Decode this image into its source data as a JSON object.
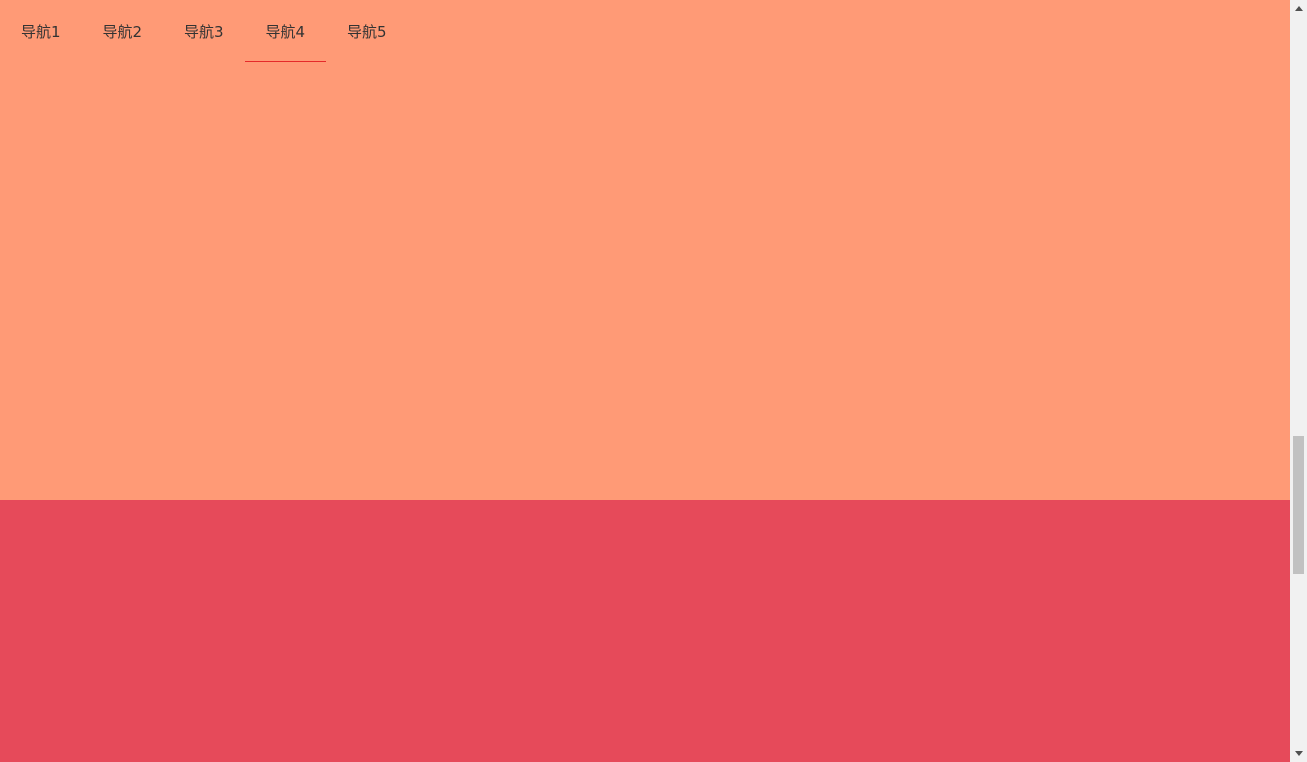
{
  "nav": {
    "items": [
      {
        "label": "导航1",
        "active": false
      },
      {
        "label": "导航2",
        "active": false
      },
      {
        "label": "导航3",
        "active": false
      },
      {
        "label": "导航4",
        "active": true
      },
      {
        "label": "导航5",
        "active": false
      }
    ]
  },
  "colors": {
    "section_orange": "#ff9a76",
    "section_red": "#e64a5a",
    "nav_active_underline": "#e52a2a",
    "nav_text": "#333333",
    "scrollbar_track": "#f1f1f1",
    "scrollbar_thumb": "#c1c1c1",
    "scroll_arrow": "#505050"
  },
  "icons": {
    "scroll_up": "triangle-up-icon",
    "scroll_down": "triangle-down-icon"
  }
}
